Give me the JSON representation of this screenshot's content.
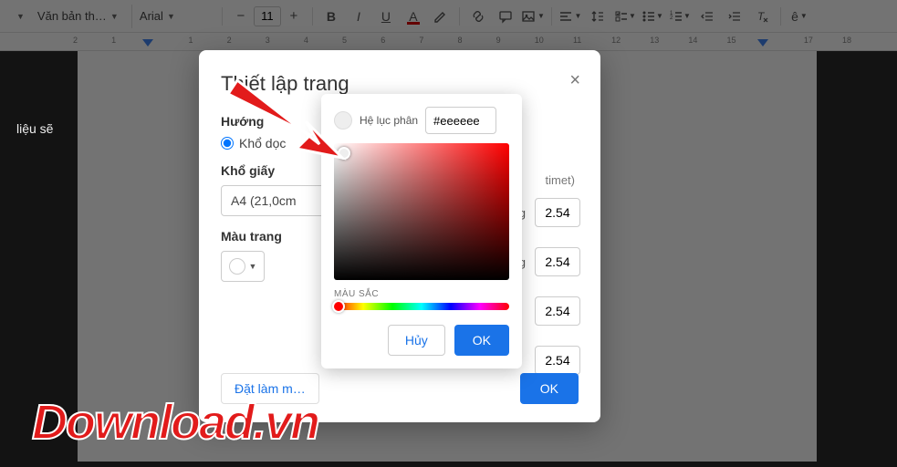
{
  "toolbar": {
    "style_text": "Văn bản th…",
    "font_family": "Arial",
    "font_size": "11",
    "bold": "B",
    "italic": "I",
    "underline": "U",
    "text_color": "A",
    "highlight": "✎",
    "link": "⊕",
    "comment": "✉",
    "image": "▣",
    "align": "≡",
    "line": "↕",
    "checklist": "☑",
    "bullets": "•",
    "numbers": "1.",
    "dec_indent": "⇤",
    "inc_indent": "⇥",
    "clear": "✕",
    "input_tools": "ê"
  },
  "ruler": {
    "ticks": [
      "2",
      "1",
      "",
      "1",
      "2",
      "3",
      "4",
      "5",
      "6",
      "7",
      "8",
      "9",
      "10",
      "11",
      "12",
      "13",
      "14",
      "15",
      "",
      "17",
      "18"
    ]
  },
  "doc": {
    "side_text": "liệu sẽ"
  },
  "dialog": {
    "title": "Thiết lập trang",
    "orientation_label": "Hướng",
    "orientation_portrait": "Khổ dọc",
    "paper_label": "Khổ giấy",
    "paper_value": "A4 (21,0cm",
    "page_color_label": "Màu trang",
    "margins_unit": "timet)",
    "margin_top_label": "ung",
    "margin_bottom_label": "ung",
    "margins": [
      "2.54",
      "2.54",
      "2.54",
      "2.54"
    ],
    "set_default": "Đặt làm m…",
    "ok": "OK"
  },
  "picker": {
    "hex_label": "Hệ lục phân",
    "hex_value": "#eeeeee",
    "hue_label": "MÀU SẮC",
    "cancel": "Hủy",
    "ok": "OK"
  },
  "watermark": "Download.vn"
}
